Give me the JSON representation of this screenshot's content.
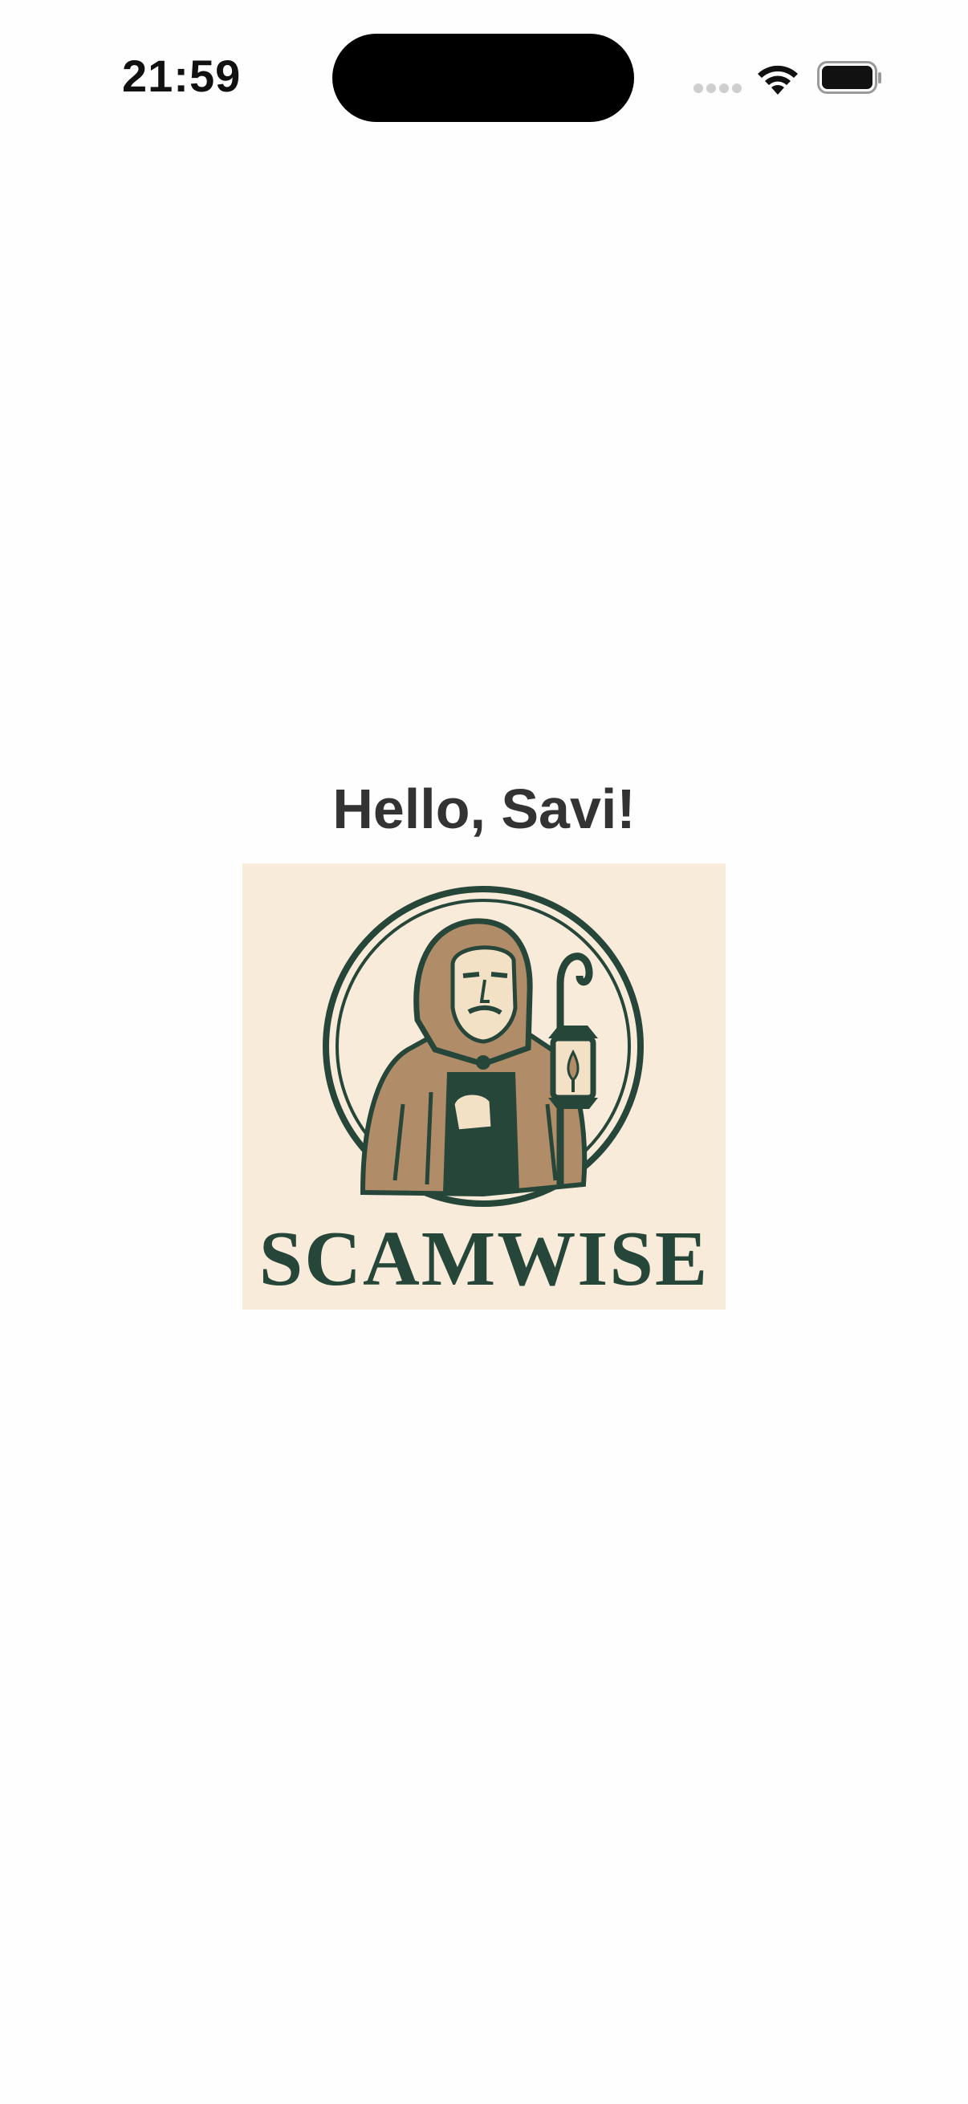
{
  "status_bar": {
    "time": "21:59",
    "icons": [
      "cellular-signal-icon",
      "wifi-icon",
      "battery-icon"
    ]
  },
  "main": {
    "greeting": "Hello, Savi!",
    "logo": {
      "icon": "hooded-monk-with-lantern-emblem",
      "wordmark": "SCAMWISE"
    }
  },
  "colors": {
    "logo_background": "#f8ebd9",
    "logo_dark_green": "#27463a",
    "logo_tan": "#b08d68",
    "logo_light_tan": "#d9bc97",
    "greeting_text": "#333333"
  }
}
